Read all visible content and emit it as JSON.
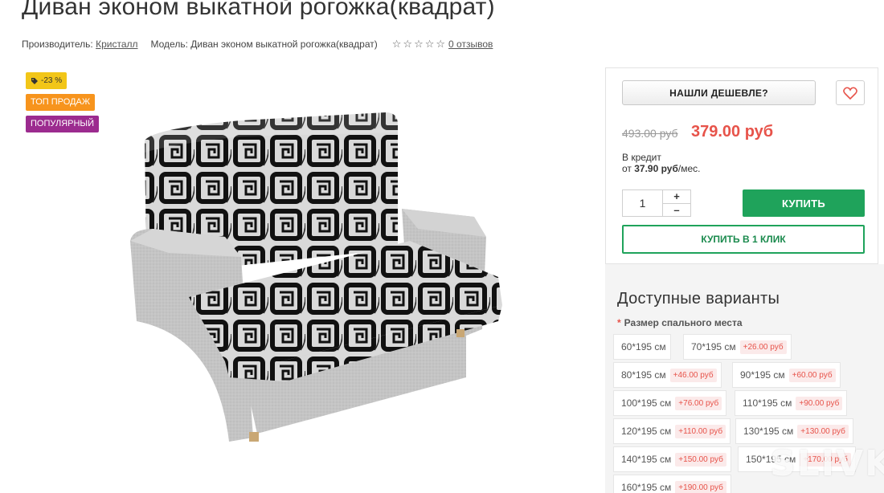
{
  "product": {
    "title": "Диван эконом выкатной рогожка(квадрат)",
    "manufacturer_label": "Производитель:",
    "manufacturer": "Кристалл",
    "model_label": "Модель:",
    "model": "Диван эконом выкатной рогожка(квадрат)",
    "rating_stars": 0,
    "reviews": "0 отзывов"
  },
  "badges": {
    "discount": "-23 %",
    "top": "ТОП ПРОДАЖ",
    "popular": "ПОПУЛЯРНЫЙ"
  },
  "purchase": {
    "cheaper_button": "НАШЛИ ДЕШЕВЛЕ?",
    "old_price": "493.00 руб",
    "new_price": "379.00 руб",
    "credit_line1": "В кредит",
    "credit_prefix": "от",
    "credit_amount": "37.90 руб",
    "credit_suffix": "/мес.",
    "quantity": "1",
    "plus": "+",
    "minus": "–",
    "buy_button": "КУПИТЬ",
    "one_click_button": "КУПИТЬ В 1 КЛИК"
  },
  "variants": {
    "title": "Доступные варианты",
    "required_mark": "*",
    "option_label": "Размер спального места",
    "options": [
      {
        "size": "60*195 см",
        "price": ""
      },
      {
        "size": "70*195 см",
        "price": "+26.00 руб"
      },
      {
        "size": "80*195 см",
        "price": "+46.00 руб"
      },
      {
        "size": "90*195 см",
        "price": "+60.00 руб"
      },
      {
        "size": "100*195 см",
        "price": "+76.00 руб"
      },
      {
        "size": "110*195 см",
        "price": "+90.00 руб"
      },
      {
        "size": "120*195 см",
        "price": "+110.00 руб"
      },
      {
        "size": "130*195 см",
        "price": "+130.00 руб"
      },
      {
        "size": "140*195 см",
        "price": "+150.00 руб"
      },
      {
        "size": "150*195 см",
        "price": "+170.00 руб"
      },
      {
        "size": "160*195 см",
        "price": "+190.00 руб"
      }
    ]
  },
  "watermark": "SLIVKI",
  "colors": {
    "accent_green": "#1fa35b",
    "price_red": "#e7534a",
    "badge_yellow": "#f2c618",
    "badge_orange": "#f7941d",
    "badge_purple": "#9c2b8f"
  }
}
